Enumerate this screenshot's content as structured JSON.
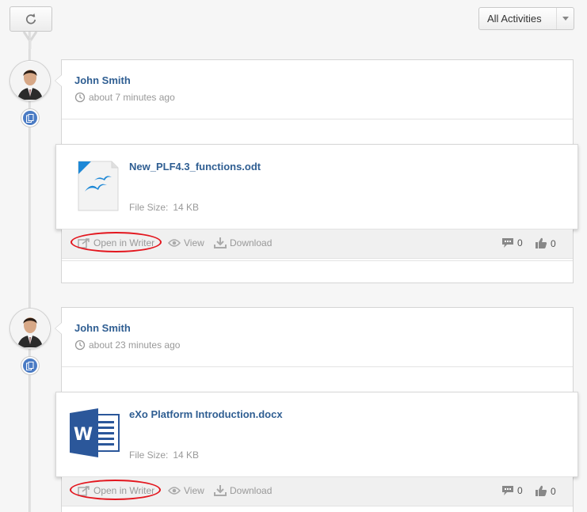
{
  "toolbar": {
    "refresh_icon": "refresh-icon",
    "filter_label": "All Activities"
  },
  "activities": [
    {
      "author": "John Smith",
      "time": "about 7 minutes ago",
      "file": {
        "name": "New_PLF4.3_functions.odt",
        "size_label": "File Size:",
        "size": "14 KB",
        "icon": "openoffice-writer-file-icon"
      },
      "actions": {
        "open": "Open in Writer",
        "view": "View",
        "download": "Download",
        "comments": "0",
        "likes": "0"
      }
    },
    {
      "author": "John Smith",
      "time": "about 23 minutes ago",
      "file": {
        "name": "eXo Platform Introduction.docx",
        "size_label": "File Size:",
        "size": "14 KB",
        "icon": "word-file-icon"
      },
      "actions": {
        "open": "Open in Writer",
        "view": "View",
        "download": "Download",
        "comments": "0",
        "likes": "0"
      }
    }
  ],
  "colors": {
    "link": "#2f5e92",
    "highlight": "#e3161e",
    "badge": "#4a7bc4",
    "word": "#2b579a"
  }
}
